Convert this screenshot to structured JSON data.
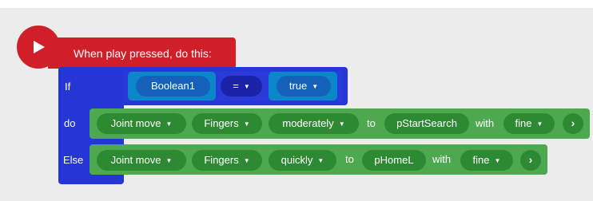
{
  "hat": {
    "label": "When play pressed, do this:"
  },
  "if_block": {
    "if_label": "If",
    "do_label": "do",
    "else_label": "Else",
    "condition": {
      "left": "Boolean1",
      "operator": "=",
      "right": "true"
    }
  },
  "do_action": {
    "type": "Joint move",
    "part": "Fingers",
    "speed": "moderately",
    "to_label": "to",
    "target": "pStartSearch",
    "with_label": "with",
    "precision": "fine",
    "more_icon": "chevron-right-icon"
  },
  "else_action": {
    "type": "Joint move",
    "part": "Fingers",
    "speed": "quickly",
    "to_label": "to",
    "target": "pHomeL",
    "with_label": "with",
    "precision": "fine",
    "more_icon": "chevron-right-icon"
  },
  "colors": {
    "hat": "#d11f2a",
    "control": "#2535d6",
    "logic": "#0a86c9",
    "action": "#4ea850",
    "field": "#2d8a33"
  }
}
